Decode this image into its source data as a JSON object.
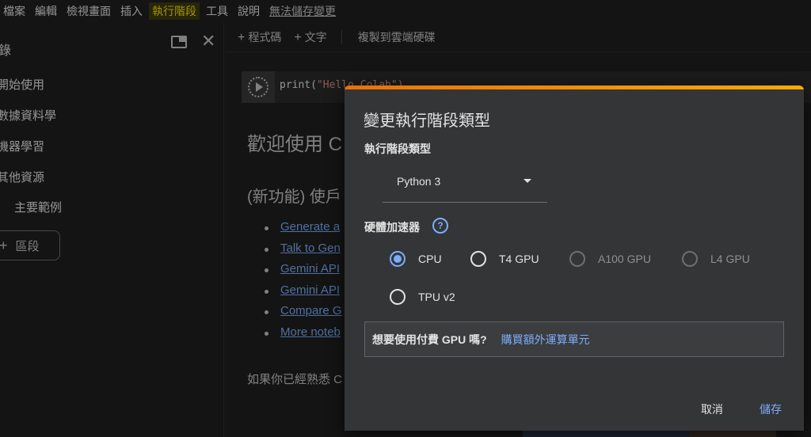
{
  "menubar": {
    "items": [
      "檔案",
      "編輯",
      "檢視畫面",
      "插入",
      "執行階段",
      "工具",
      "說明"
    ],
    "unsaved": "無法儲存變更"
  },
  "sidebar": {
    "title": "錄",
    "toc": [
      "開始使用",
      "數據資料學",
      "機器學習",
      "其他資源",
      "主要範例"
    ],
    "add_section": "區段"
  },
  "toolbar": {
    "add_code": "程式碼",
    "add_text": "文字",
    "copy_to_drive": "複製到雲端硬碟"
  },
  "cell": {
    "code_fn": "print(",
    "code_str": "\"Hello Colab\")"
  },
  "notebook": {
    "h1": "歡迎使用 C",
    "h2": "(新功能) 使戶",
    "links": [
      "Generate a",
      "Talk to Gen",
      "Gemini API",
      "Gemini API",
      "Compare G",
      "More noteb"
    ],
    "para": "如果你已經熟悉 C"
  },
  "dialog": {
    "title": "變更執行階段類型",
    "runtime_label": "執行階段類型",
    "runtime_value": "Python 3",
    "accelerator_label": "硬體加速器",
    "help": "?",
    "options": [
      {
        "label": "CPU",
        "selected": true,
        "disabled": false
      },
      {
        "label": "T4 GPU",
        "selected": false,
        "disabled": false
      },
      {
        "label": "A100 GPU",
        "selected": false,
        "disabled": true
      },
      {
        "label": "L4 GPU",
        "selected": false,
        "disabled": true
      },
      {
        "label": "TPU v2",
        "selected": false,
        "disabled": false
      }
    ],
    "promo_question": "想要使用付費 GPU 嗎?",
    "promo_link": "購買額外運算單元",
    "cancel": "取消",
    "save": "儲存"
  },
  "colors": {
    "accent": "#7cacf8",
    "active_menu": "#f6e200",
    "dialog_bg": "#333537",
    "progress_start": "#e8710a",
    "progress_end": "#f9ab00"
  }
}
